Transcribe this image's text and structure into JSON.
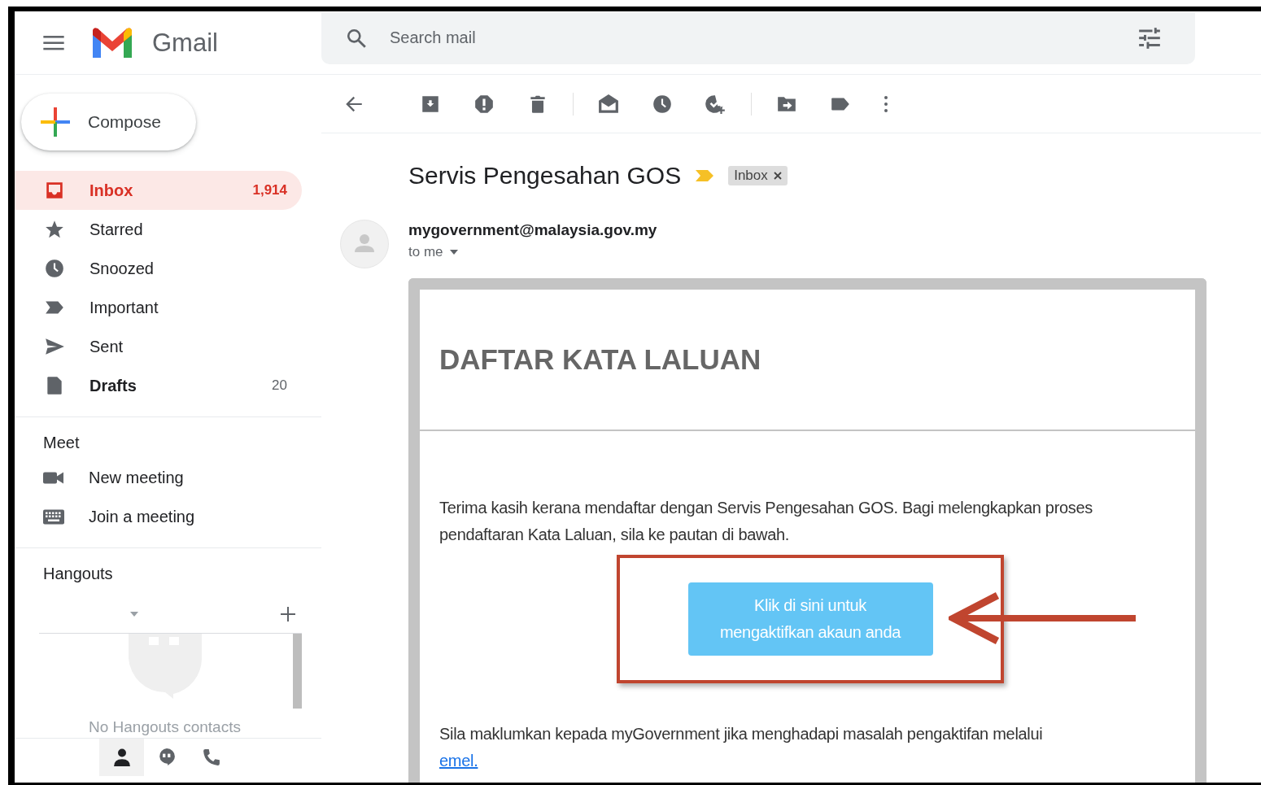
{
  "header": {
    "app_name": "Gmail",
    "search": {
      "placeholder": "Search mail"
    }
  },
  "compose": {
    "label": "Compose"
  },
  "nav": [
    {
      "kind": "inbox",
      "label": "Inbox",
      "count": "1,914",
      "selected": true,
      "unread": true
    },
    {
      "kind": "star",
      "label": "Starred",
      "selected": false,
      "unread": false
    },
    {
      "kind": "clock",
      "label": "Snoozed",
      "selected": false,
      "unread": false
    },
    {
      "kind": "important",
      "label": "Important",
      "selected": false,
      "unread": false
    },
    {
      "kind": "send",
      "label": "Sent",
      "selected": false,
      "unread": false
    },
    {
      "kind": "draft",
      "label": "Drafts",
      "count": "20",
      "selected": false,
      "unread": true
    }
  ],
  "meet": {
    "title": "Meet",
    "items": [
      {
        "kind": "video",
        "label": "New meeting"
      },
      {
        "kind": "keyboard",
        "label": "Join a meeting"
      }
    ]
  },
  "hangouts": {
    "title": "Hangouts",
    "empty_text": "No Hangouts contacts",
    "tabs": [
      {
        "kind": "person",
        "selected": true
      },
      {
        "kind": "chat",
        "selected": false
      },
      {
        "kind": "phone",
        "selected": false
      }
    ]
  },
  "email": {
    "subject": "Servis Pengesahan GOS",
    "label_chip": "Inbox",
    "sender": "mygovernment@malaysia.gov.my",
    "recipient": "to me",
    "heading": "DAFTAR KATA LALUAN",
    "paragraph": "Terima kasih kerana mendaftar dengan Servis Pengesahan GOS. Bagi melengkapkan proses pendaftaran Kata Laluan, sila ke pautan di bawah.",
    "button": "Klik di sini untuk mengaktifkan akaun anda",
    "footer": "Sila maklumkan kepada myGovernment jika menghadapi masalah pengaktifan melalui",
    "link": "emel."
  }
}
